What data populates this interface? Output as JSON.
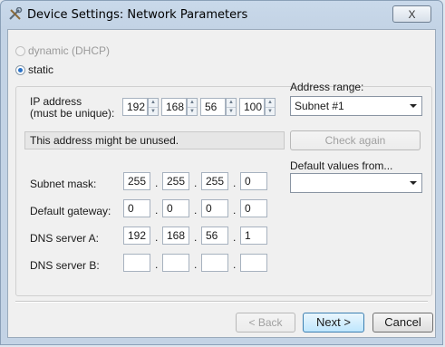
{
  "window": {
    "title": "Device Settings: Network Parameters",
    "close_label": "X"
  },
  "mode": {
    "dynamic_label": "dynamic (DHCP)",
    "static_label": "static",
    "selected": "static"
  },
  "ip": {
    "label_line1": "IP address",
    "label_line2": "(must be unique):",
    "octets": [
      "192",
      "168",
      "56",
      "100"
    ]
  },
  "status_text": "This address might be unused.",
  "address_range": {
    "label": "Address range:",
    "value": "Subnet #1"
  },
  "check_again_label": "Check again",
  "defaults": {
    "label": "Default values from...",
    "value": ""
  },
  "subnet": {
    "label": "Subnet mask:",
    "octets": [
      "255",
      "255",
      "255",
      "0"
    ]
  },
  "gateway": {
    "label": "Default gateway:",
    "octets": [
      "0",
      "0",
      "0",
      "0"
    ]
  },
  "dns_a": {
    "label": "DNS server A:",
    "octets": [
      "192",
      "168",
      "56",
      "1"
    ]
  },
  "dns_b": {
    "label": "DNS server B:",
    "octets": [
      "",
      "",
      "",
      ""
    ]
  },
  "dot": ".",
  "spin_up": "▲",
  "spin_down": "▼",
  "buttons": {
    "back": "< Back",
    "next": "Next >",
    "cancel": "Cancel"
  }
}
